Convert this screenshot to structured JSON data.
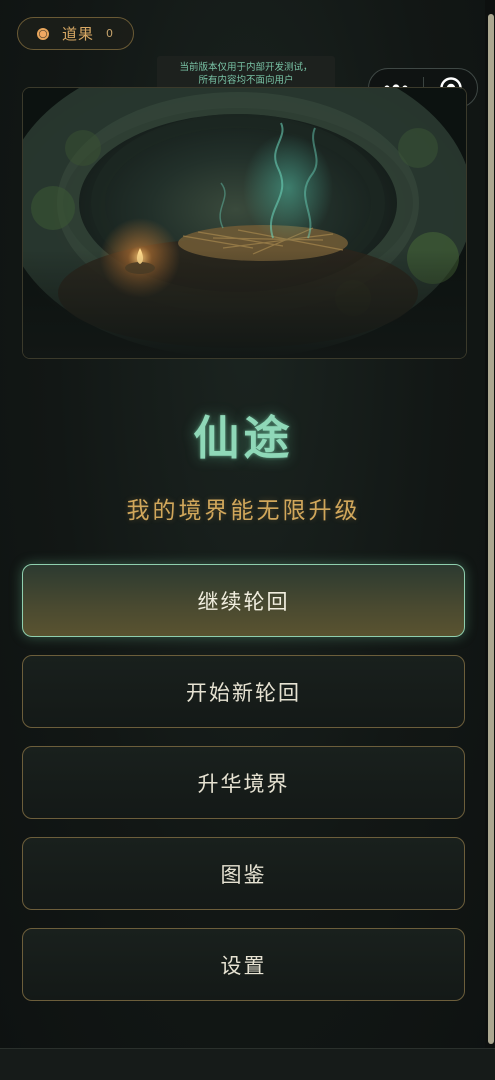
{
  "currency": {
    "icon": "orb-icon",
    "name": "道果",
    "count": "0"
  },
  "dev_notice": {
    "line1": "当前版本仅用于内部开发测试，",
    "line2": "所有内容均不面向用户"
  },
  "capsule": {
    "more_icon": "more-dots-icon",
    "close_icon": "target-close-icon"
  },
  "hero": {
    "scene": "cave-interior-image"
  },
  "title": "仙途",
  "subtitle": "我的境界能无限升级",
  "menu": [
    {
      "label": "继续轮回",
      "primary": true
    },
    {
      "label": "开始新轮回",
      "primary": false
    },
    {
      "label": "升华境界",
      "primary": false
    },
    {
      "label": "图鉴",
      "primary": false
    },
    {
      "label": "设置",
      "primary": false
    }
  ],
  "colors": {
    "accent_jade": "#8fd8b8",
    "accent_gold": "#d1a75b",
    "border_gold": "#6c5e3b",
    "background": "#121614"
  }
}
